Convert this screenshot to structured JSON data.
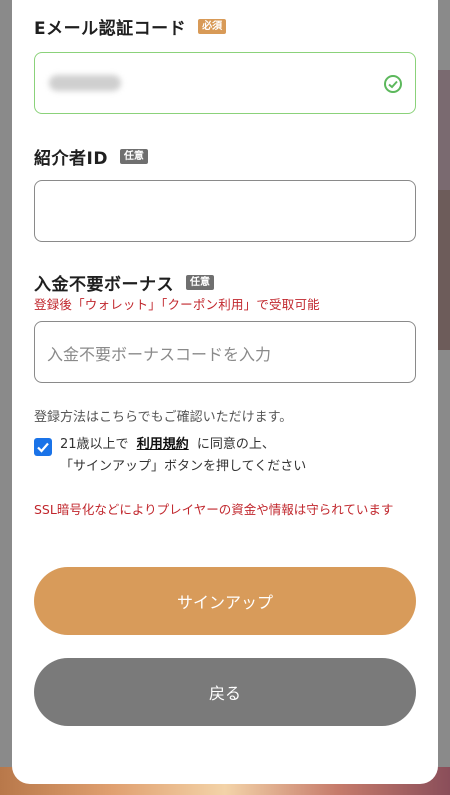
{
  "email_code": {
    "label": "Eメール認証コード",
    "tag": "必須",
    "value_visible": "blurred"
  },
  "referrer": {
    "label": "紹介者ID",
    "tag": "任意",
    "value": ""
  },
  "bonus": {
    "label": "入金不要ボーナス",
    "tag": "任意",
    "note": "登録後「ウォレット」「クーポン利用」で受取可能",
    "placeholder": "入金不要ボーナスコードを入力"
  },
  "info_text": "登録方法はこちらでもご確認いただけます。",
  "agreement": {
    "checked": true,
    "prefix": "21歳以上で",
    "terms_link": "利用規約",
    "suffix": "に同意の上、",
    "line2": "「サインアップ」ボタンを押してください"
  },
  "ssl_note": "SSL暗号化などによりプレイヤーの資金や情報は守られています",
  "buttons": {
    "signup": "サインアップ",
    "back": "戻る"
  },
  "colors": {
    "accent": "#d89b5a",
    "valid": "#8bd27a",
    "warning": "#c1272d",
    "checkbox": "#1a73e8",
    "back_button": "#7a7a7a"
  },
  "icons": {
    "email_valid": "check-circle-icon",
    "agree_checkbox": "checkmark-icon"
  }
}
